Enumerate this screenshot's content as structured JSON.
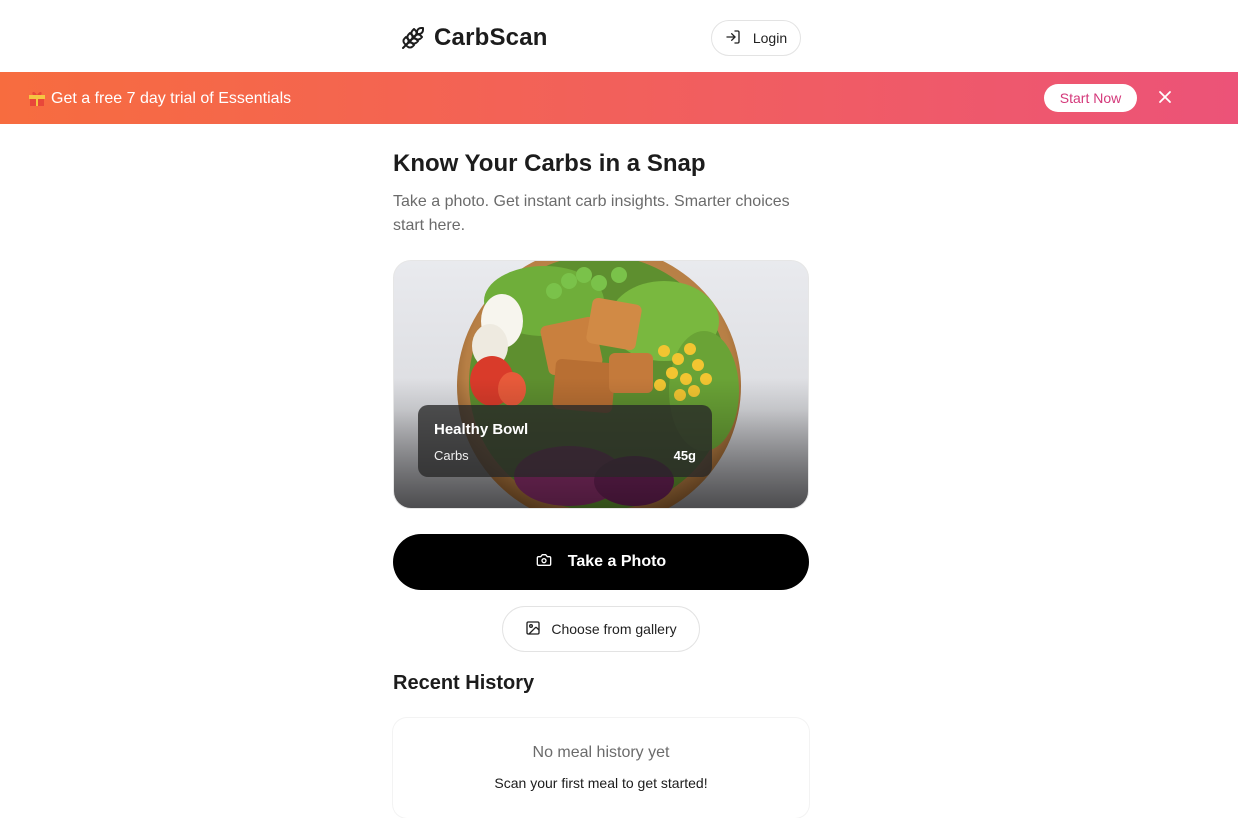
{
  "header": {
    "app_name": "CarbScan",
    "logo_icon": "wheat-icon",
    "login_label": "Login",
    "login_icon": "login-arrow-icon"
  },
  "promo": {
    "gift_icon": "gift-icon",
    "text": "Get a free 7 day trial of Essentials",
    "start_label": "Start Now",
    "close_icon": "close-icon",
    "gradient_start": "#f76c3f",
    "gradient_end": "#ec5378"
  },
  "hero": {
    "title": "Know Your Carbs in a Snap",
    "subtitle": "Take a photo. Get instant carb insights. Smarter choices start here."
  },
  "sample_card": {
    "meal_name": "Healthy Bowl",
    "nutrient_label": "Carbs",
    "nutrient_value": "45g"
  },
  "actions": {
    "take_photo_label": "Take a Photo",
    "take_photo_icon": "camera-icon",
    "gallery_label": "Choose from gallery",
    "gallery_icon": "image-icon"
  },
  "history": {
    "title": "Recent History",
    "empty_text": "No meal history yet",
    "hint_text": "Scan your first meal to get started!"
  }
}
